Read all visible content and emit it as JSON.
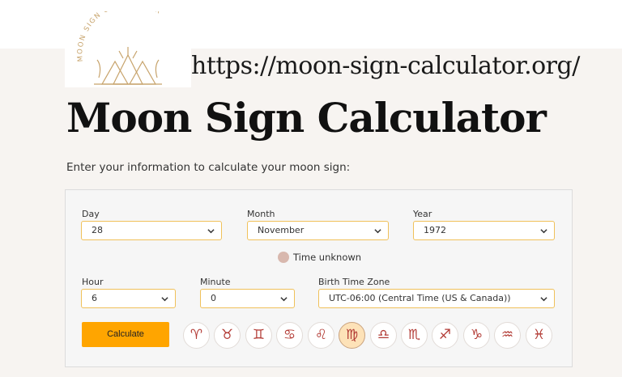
{
  "logo": {
    "text": "MOON SIGN CALCULATOR"
  },
  "site_url": "https://moon-sign-calculator.org/",
  "page": {
    "title": "Moon Sign Calculator",
    "intro": "Enter your information to calculate your moon sign:"
  },
  "form": {
    "day": {
      "label": "Day",
      "value": "28"
    },
    "month": {
      "label": "Month",
      "value": "November"
    },
    "year": {
      "label": "Year",
      "value": "1972"
    },
    "time_unknown_label": "Time unknown",
    "hour": {
      "label": "Hour",
      "value": "6"
    },
    "minute": {
      "label": "Minute",
      "value": "0"
    },
    "timezone": {
      "label": "Birth Time Zone",
      "value": "UTC-06:00 (Central Time (US & Canada))"
    },
    "calculate_label": "Calculate"
  },
  "zodiac_signs": [
    {
      "name": "aries",
      "glyph": "♈"
    },
    {
      "name": "taurus",
      "glyph": "♉"
    },
    {
      "name": "gemini",
      "glyph": "♊"
    },
    {
      "name": "cancer",
      "glyph": "♋"
    },
    {
      "name": "leo",
      "glyph": "♌"
    },
    {
      "name": "virgo",
      "glyph": "♍",
      "active": true
    },
    {
      "name": "libra",
      "glyph": "♎"
    },
    {
      "name": "scorpio",
      "glyph": "♏"
    },
    {
      "name": "sagittarius",
      "glyph": "♐"
    },
    {
      "name": "capricorn",
      "glyph": "♑"
    },
    {
      "name": "aquarius",
      "glyph": "♒"
    },
    {
      "name": "pisces",
      "glyph": "♓"
    }
  ],
  "colors": {
    "accent": "#ffa500",
    "select_border": "#f0c15a",
    "zodiac_glyph": "#b23a34",
    "logo_gold": "#c7a36b"
  }
}
